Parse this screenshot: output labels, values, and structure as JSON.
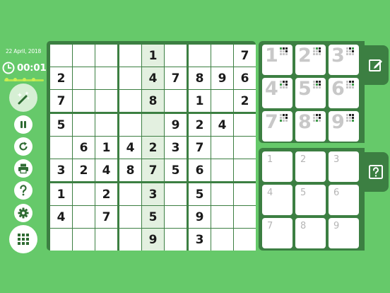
{
  "header": {
    "date": "22 April, 2018",
    "timer": "00:01"
  },
  "progress": {
    "fraction": 0.0
  },
  "sidebar": {
    "tools": [
      {
        "name": "magic-wand-button",
        "icon": "magic-wand-icon"
      },
      {
        "name": "pause-button",
        "icon": "pause-icon"
      },
      {
        "name": "restart-button",
        "icon": "restart-icon"
      },
      {
        "name": "print-button",
        "icon": "printer-icon"
      },
      {
        "name": "help-button",
        "icon": "question-icon"
      },
      {
        "name": "settings-button",
        "icon": "gear-icon"
      },
      {
        "name": "menu-button",
        "icon": "grid-menu-icon"
      }
    ]
  },
  "board": {
    "rows": [
      [
        "",
        "",
        "",
        "",
        "1",
        "",
        "",
        "",
        "7"
      ],
      [
        "2",
        "",
        "",
        "",
        "4",
        "7",
        "8",
        "9",
        "6"
      ],
      [
        "7",
        "",
        "",
        "",
        "8",
        "",
        "1",
        "",
        "2"
      ],
      [
        "5",
        "",
        "",
        "",
        "",
        "9",
        "2",
        "4",
        ""
      ],
      [
        "",
        "6",
        "1",
        "4",
        "2",
        "3",
        "7",
        "",
        ""
      ],
      [
        "3",
        "2",
        "4",
        "8",
        "7",
        "5",
        "6",
        "",
        ""
      ],
      [
        "1",
        "",
        "2",
        "",
        "3",
        "",
        "5",
        "",
        ""
      ],
      [
        "4",
        "",
        "7",
        "",
        "5",
        "",
        "9",
        "",
        ""
      ],
      [
        "",
        "",
        "",
        "",
        "9",
        "",
        "3",
        "",
        ""
      ]
    ],
    "highlight_col": 4
  },
  "number_pad": {
    "digits": [
      "1",
      "2",
      "3",
      "4",
      "5",
      "6",
      "7",
      "8",
      "9"
    ],
    "edit_icon": "pencil-edit-icon"
  },
  "notes_pad": {
    "digits": [
      "1",
      "2",
      "3",
      "4",
      "5",
      "6",
      "7",
      "8",
      "9"
    ],
    "hint_icon": "question-box-icon"
  },
  "colors": {
    "background": "#66c96a",
    "frame": "#3c7f42",
    "highlight": "#e3f0e0",
    "digit": "#1a1a1a",
    "pad_digit": "#c8c8c8"
  }
}
